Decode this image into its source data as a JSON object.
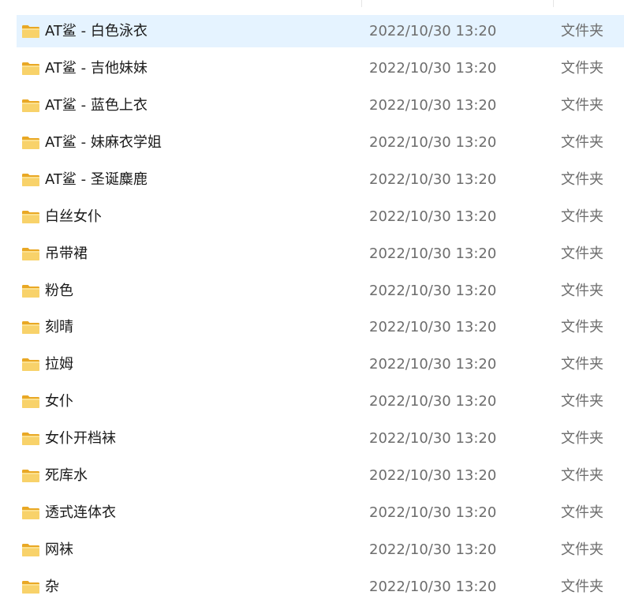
{
  "selected_index": 0,
  "colors": {
    "selection": "#e5f3ff",
    "folder": "#f8c43f"
  },
  "rows": [
    {
      "name": "AT鲨 - 白色泳衣",
      "date": "2022/10/30 13:20",
      "type": "文件夹",
      "icon": "folder-icon"
    },
    {
      "name": "AT鲨 - 吉他妹妹",
      "date": "2022/10/30 13:20",
      "type": "文件夹",
      "icon": "folder-icon"
    },
    {
      "name": "AT鲨 - 蓝色上衣",
      "date": "2022/10/30 13:20",
      "type": "文件夹",
      "icon": "folder-icon"
    },
    {
      "name": "AT鲨 - 妹麻衣学姐",
      "date": "2022/10/30 13:20",
      "type": "文件夹",
      "icon": "folder-icon"
    },
    {
      "name": "AT鲨 - 圣诞麋鹿",
      "date": "2022/10/30 13:20",
      "type": "文件夹",
      "icon": "folder-icon"
    },
    {
      "name": "白丝女仆",
      "date": "2022/10/30 13:20",
      "type": "文件夹",
      "icon": "folder-icon"
    },
    {
      "name": "吊带裙",
      "date": "2022/10/30 13:20",
      "type": "文件夹",
      "icon": "folder-icon"
    },
    {
      "name": "粉色",
      "date": "2022/10/30 13:20",
      "type": "文件夹",
      "icon": "folder-icon"
    },
    {
      "name": "刻晴",
      "date": "2022/10/30 13:20",
      "type": "文件夹",
      "icon": "folder-icon"
    },
    {
      "name": "拉姆",
      "date": "2022/10/30 13:20",
      "type": "文件夹",
      "icon": "folder-icon"
    },
    {
      "name": "女仆",
      "date": "2022/10/30 13:20",
      "type": "文件夹",
      "icon": "folder-icon"
    },
    {
      "name": "女仆开档袜",
      "date": "2022/10/30 13:20",
      "type": "文件夹",
      "icon": "folder-icon"
    },
    {
      "name": "死库水",
      "date": "2022/10/30 13:20",
      "type": "文件夹",
      "icon": "folder-icon"
    },
    {
      "name": "透式连体衣",
      "date": "2022/10/30 13:20",
      "type": "文件夹",
      "icon": "folder-icon"
    },
    {
      "name": "网袜",
      "date": "2022/10/30 13:20",
      "type": "文件夹",
      "icon": "folder-icon"
    },
    {
      "name": "杂",
      "date": "2022/10/30 13:20",
      "type": "文件夹",
      "icon": "folder-icon"
    }
  ]
}
